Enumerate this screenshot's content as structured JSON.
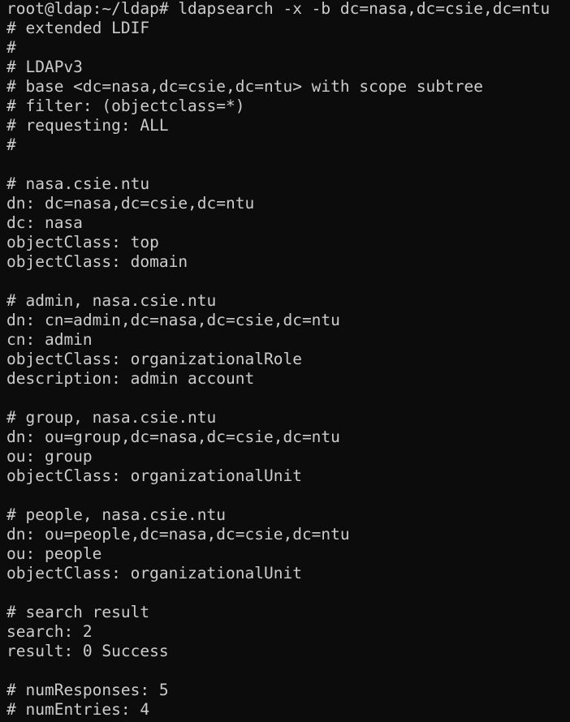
{
  "terminal": {
    "lines": [
      "root@ldap:~/ldap# ldapsearch -x -b dc=nasa,dc=csie,dc=ntu",
      "# extended LDIF",
      "#",
      "# LDAPv3",
      "# base <dc=nasa,dc=csie,dc=ntu> with scope subtree",
      "# filter: (objectclass=*)",
      "# requesting: ALL",
      "#",
      "",
      "# nasa.csie.ntu",
      "dn: dc=nasa,dc=csie,dc=ntu",
      "dc: nasa",
      "objectClass: top",
      "objectClass: domain",
      "",
      "# admin, nasa.csie.ntu",
      "dn: cn=admin,dc=nasa,dc=csie,dc=ntu",
      "cn: admin",
      "objectClass: organizationalRole",
      "description: admin account",
      "",
      "# group, nasa.csie.ntu",
      "dn: ou=group,dc=nasa,dc=csie,dc=ntu",
      "ou: group",
      "objectClass: organizationalUnit",
      "",
      "# people, nasa.csie.ntu",
      "dn: ou=people,dc=nasa,dc=csie,dc=ntu",
      "ou: people",
      "objectClass: organizationalUnit",
      "",
      "# search result",
      "search: 2",
      "result: 0 Success",
      "",
      "# numResponses: 5",
      "# numEntries: 4"
    ]
  },
  "colors": {
    "background": "#0c0c0c",
    "foreground": "#cccccc"
  }
}
